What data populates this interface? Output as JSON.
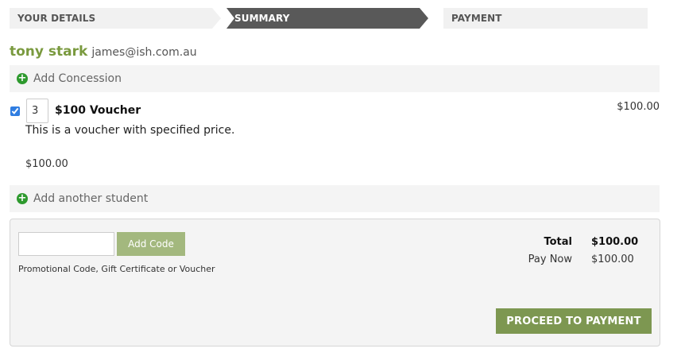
{
  "steps": [
    {
      "label": "YOUR DETAILS",
      "state": "done"
    },
    {
      "label": "SUMMARY",
      "state": "active"
    },
    {
      "label": "PAYMENT",
      "state": "pending"
    }
  ],
  "student": {
    "name": "tony stark",
    "email": "james@ish.com.au",
    "add_concession_label": "Add Concession",
    "add_student_label": "Add another student"
  },
  "item": {
    "checked": true,
    "quantity": "3",
    "name": "$100 Voucher",
    "description": "This is a voucher with specified price.",
    "price": "$100.00",
    "line_total": "$100.00"
  },
  "promo": {
    "value": "",
    "placeholder": "",
    "button_label": "Add Code",
    "hint": "Promotional Code, Gift Certificate or Voucher"
  },
  "totals": {
    "total_label": "Total",
    "total_value": "$100.00",
    "paynow_label": "Pay Now",
    "paynow_value": "$100.00"
  },
  "actions": {
    "proceed_label": "PROCEED TO PAYMENT"
  },
  "colors": {
    "brand_green": "#7a9a3f",
    "active_step": "#595959",
    "add_icon_green": "#2e9a2e",
    "proceed_button": "#7d9751"
  }
}
